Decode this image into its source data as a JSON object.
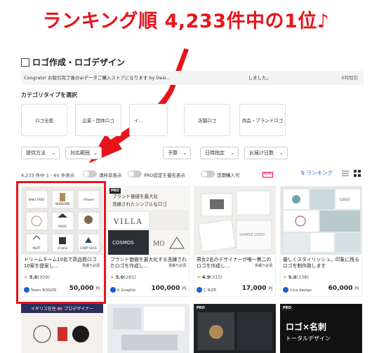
{
  "headline": "ランキング順 4,233件中の1位♪",
  "page_title": "ロゴ作成・ロゴデザイン",
  "notice": {
    "text": "Congrats! お取引完了後のaiデータご購入ストアになります by Desi…　　　　　　　　　　　　　　　　　しました。",
    "time": "8時間前"
  },
  "section_label": "カテゴリタイプを選択",
  "categories": [
    "ロゴ全般",
    "企業・団体ロゴ",
    "イ…",
    "店舗ロゴ",
    "商品・ブランドロゴ"
  ],
  "filters": [
    "提供方法",
    "対応範囲",
    "予算",
    "日時指定",
    "お届け日数"
  ],
  "count_text": "4,233 件中 1 - 60 件表示",
  "toggles": [
    "満枠非表示",
    "PRO認定を優先表示",
    "定期購入可"
  ],
  "new_badge": "NEW",
  "ranking_label": "ランキング",
  "cards": [
    {
      "title": "ドリームチーム10名で高品質ロゴ10案を提案し…",
      "tag": "見積り必須",
      "stars": "★",
      "rating": "5.0",
      "reviews": "(309)",
      "seller": "Team ROGOS",
      "price": "50,000",
      "unit": "円",
      "pro": ""
    },
    {
      "title": "ブランド価値を最大化する洗練されたロゴを作成し…",
      "tag": "見積り必須",
      "stars": "★",
      "rating": "5.0",
      "reviews": "(281)",
      "seller": "K Graphic",
      "price": "100,000",
      "unit": "円",
      "pro": "PRO"
    },
    {
      "title": "男女2名のデザイナーが唯一無二のロゴを作成し…",
      "tag": "見積り必須",
      "stars": "★",
      "rating": "4.9",
      "reviews": "(315)",
      "seller": "C RIZE",
      "price": "17,000",
      "unit": "円",
      "pro": ""
    },
    {
      "title": "優しくスタイリッシュ。印象に残るロゴを制作致します",
      "tag": "",
      "stars": "★",
      "rating": "5.0",
      "reviews": "(338)",
      "seller": "nica design",
      "price": "60,000",
      "unit": "円",
      "pro": ""
    }
  ],
  "thumb_text": {
    "c1": [
      "RAKU TARO",
      "SKINSOME",
      "I-Planet",
      "RAVIS",
      "MyBT",
      "i-Flame",
      "CAMP HUCK"
    ],
    "c2a": "ブランド価値を最大化",
    "c2b": "洗練されたシンプルなロゴ",
    "c2c": "VILLA",
    "c2d": "COSMOS",
    "c2e": "MO",
    "c3": "SAMPLE LOGO",
    "c4": "LOGO"
  },
  "row2": {
    "c1": "イギリス在住 🇬🇧 プロデザイナー",
    "c4": "ロゴ×名刺",
    "c4b": "トータルデザイン",
    "c3pro": "PRO",
    "c4pro": "PRO"
  }
}
